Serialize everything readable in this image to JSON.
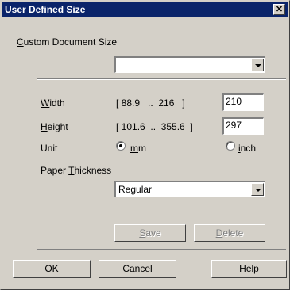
{
  "window": {
    "title": "User Defined Size",
    "close_glyph": "✕"
  },
  "custom_size": {
    "label_prefix": "",
    "label_underline": "C",
    "label_rest": "ustom Document Size",
    "value": ""
  },
  "width": {
    "label_underline": "W",
    "label_rest": "idth",
    "range": "[ 88.9   ..  216   ]",
    "value": "210"
  },
  "height": {
    "label_underline": "H",
    "label_rest": "eight",
    "range": "[ 101.6  ..  355.6  ]",
    "value": "297"
  },
  "unit": {
    "label": "Unit",
    "options": [
      {
        "underline": "m",
        "rest": "m",
        "selected": true
      },
      {
        "underline": "i",
        "rest": "nch",
        "selected": false
      }
    ]
  },
  "paper_thickness": {
    "label_prefix": "Paper ",
    "label_underline": "T",
    "label_rest": "hickness",
    "value": "Regular"
  },
  "buttons": {
    "save": {
      "underline": "S",
      "rest": "ave"
    },
    "delete": {
      "underline": "D",
      "rest": "elete"
    },
    "ok": "OK",
    "cancel": "Cancel",
    "help": {
      "underline": "H",
      "rest": "elp"
    }
  }
}
